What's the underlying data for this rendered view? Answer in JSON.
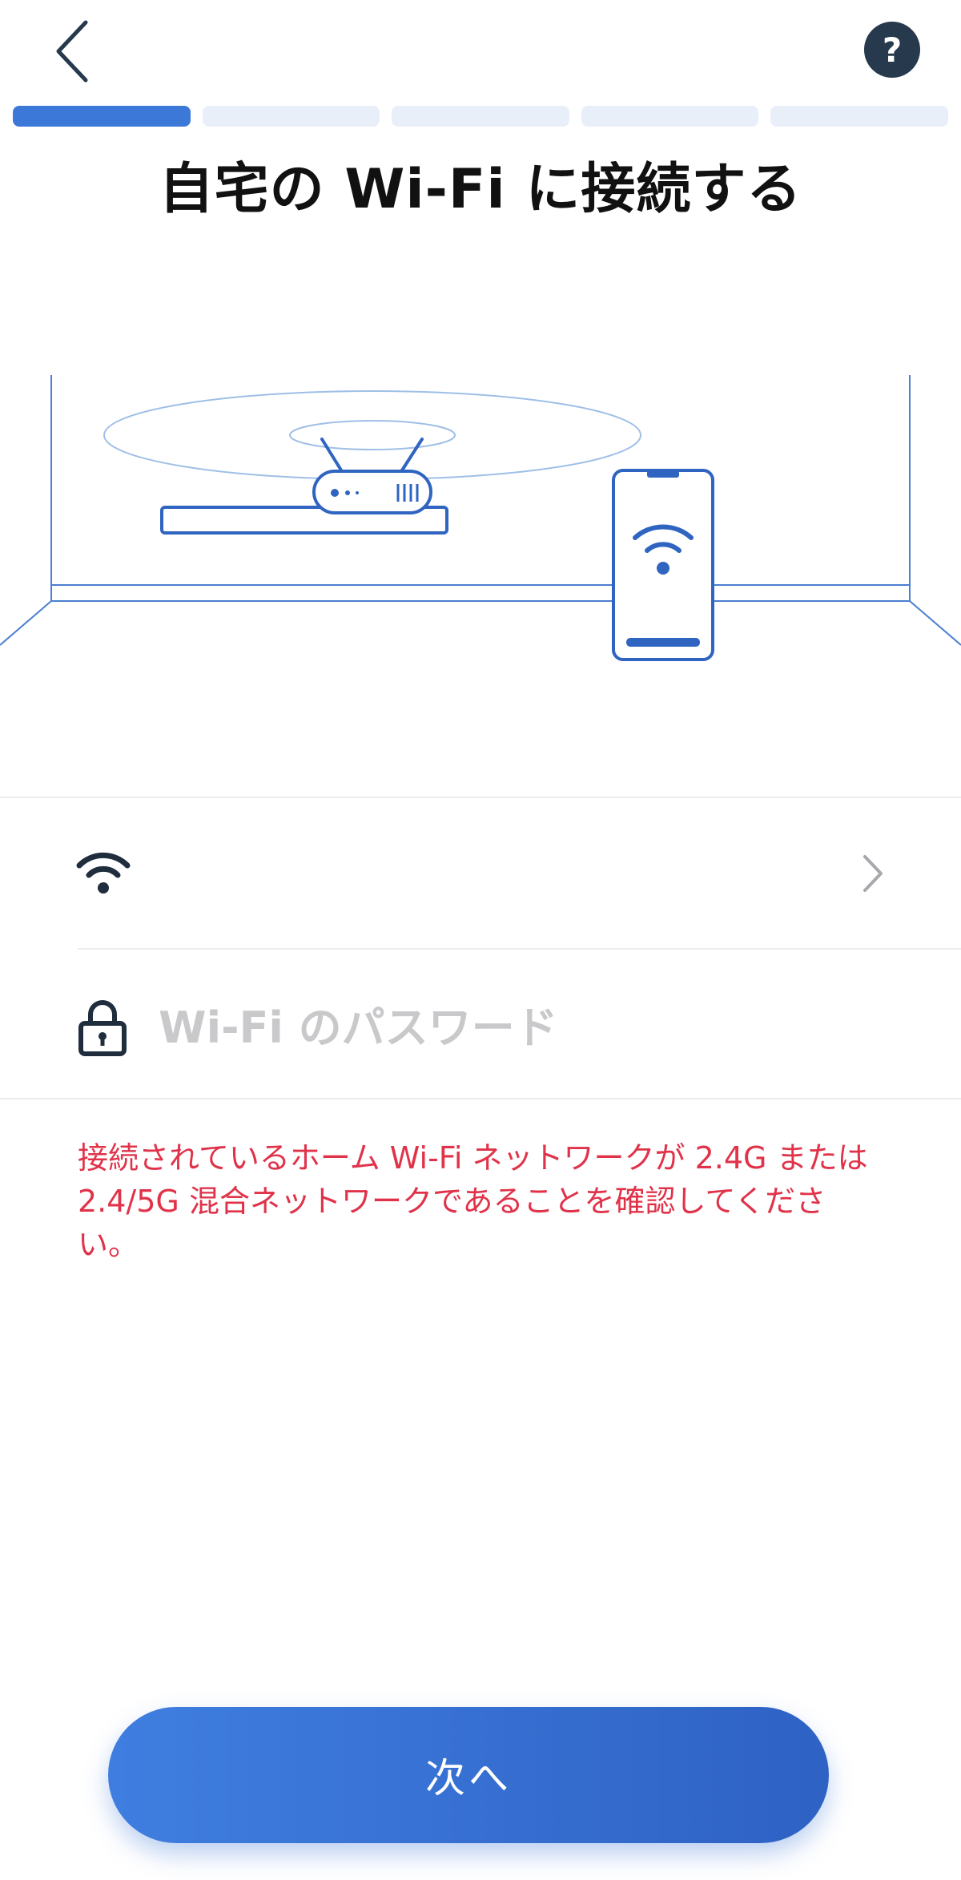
{
  "header": {
    "back_icon": "chevron-left-icon",
    "help_label": "?"
  },
  "progress": {
    "total_steps": 5,
    "current_step": 1
  },
  "title": "自宅の Wi-Fi に接続する",
  "network": {
    "icon": "wifi-icon",
    "selected_name": "",
    "chevron_icon": "chevron-right-icon"
  },
  "password": {
    "icon": "lock-icon",
    "value": "",
    "placeholder": "Wi-Fi のパスワード"
  },
  "warning_text": "接続されているホーム Wi-Fi ネットワークが 2.4G または 2.4/5G 混合ネットワークであることを確認してください。",
  "next_button_label": "次へ",
  "colors": {
    "accent": "#3c78d8",
    "progress_inactive": "#e9eff8",
    "warning": "#e0334a",
    "help_bg": "#26394d",
    "placeholder": "#c9c9cc"
  }
}
